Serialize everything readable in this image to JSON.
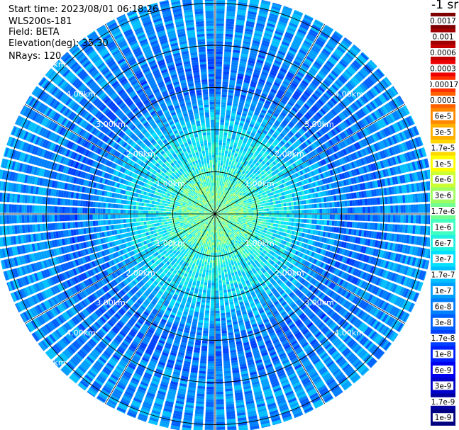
{
  "info": {
    "start_time": "Start time: 2023/08/01 06:18:26",
    "device": "WLS200s-181",
    "field": "Field: BETA",
    "elevation": "Elevation(deg): 35.30",
    "nrays": "NRays: 120"
  },
  "colorbar": {
    "unit_label": "-1 sr",
    "ticks": [
      "0.0017",
      "0.001",
      "0.0006",
      "0.0003",
      "0.00017",
      "0.0001",
      "6e-5",
      "3e-5",
      "1.7e-5",
      "1e-5",
      "6e-6",
      "3e-6",
      "1.7e-6",
      "1e-6",
      "6e-7",
      "3e-7",
      "1.7e-7",
      "1e-7",
      "6e-8",
      "3e-8",
      "1.7e-8",
      "1e-8",
      "6e-9",
      "3e-9",
      "1.7e-9",
      "1e-9"
    ],
    "colors": [
      "#800000",
      "#a00000",
      "#c40000",
      "#ee0000",
      "#ff3000",
      "#ff6000",
      "#ff8800",
      "#ffb000",
      "#ffd800",
      "#ffff00",
      "#ccff33",
      "#a0ff60",
      "#70ff90",
      "#40ffc0",
      "#20f0e0",
      "#00e0ff",
      "#00c0ff",
      "#00a0ff",
      "#0080ff",
      "#0060ff",
      "#0040ff",
      "#0020ff",
      "#0000f0",
      "#0000c8",
      "#0000a0",
      "#000080"
    ]
  },
  "chart_data": {
    "type": "polar-ppi",
    "field": "BETA",
    "elevation_deg": 35.3,
    "nrays": 120,
    "range_rings_km": [
      1,
      2,
      3,
      4,
      5
    ],
    "ring_labels": [
      "1.00km",
      "2.00km",
      "3.00km",
      "4.00km",
      "5.00km"
    ],
    "spoke_spacing_deg": 30,
    "max_range_km": 5.2,
    "color_scale": "log",
    "value_range": [
      1e-09,
      0.0017
    ],
    "radial_profile": [
      {
        "range_km": 0.0,
        "value": 1.7e-06
      },
      {
        "range_km": 0.5,
        "value": 1.5e-06
      },
      {
        "range_km": 1.0,
        "value": 8e-07
      },
      {
        "range_km": 1.5,
        "value": 4e-07
      },
      {
        "range_km": 2.0,
        "value": 2.5e-07
      },
      {
        "range_km": 2.5,
        "value": 1.2e-07
      },
      {
        "range_km": 3.0,
        "value": 5e-08
      },
      {
        "range_km": 3.5,
        "value": 4e-08
      },
      {
        "range_km": 4.0,
        "value": 7e-08
      },
      {
        "range_km": 4.5,
        "value": 8e-08
      },
      {
        "range_km": 5.0,
        "value": 9e-08
      }
    ]
  }
}
